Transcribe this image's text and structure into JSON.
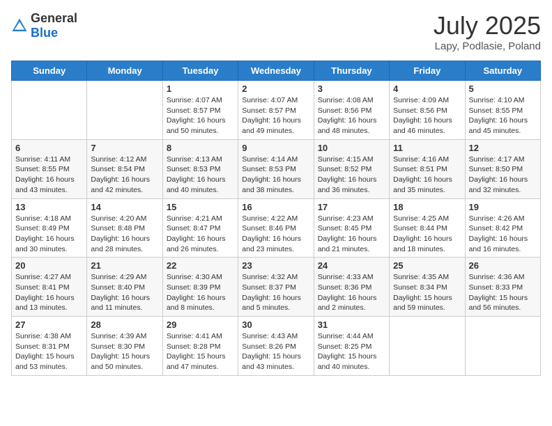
{
  "header": {
    "logo_general": "General",
    "logo_blue": "Blue",
    "month_title": "July 2025",
    "location": "Lapy, Podlasie, Poland"
  },
  "days_of_week": [
    "Sunday",
    "Monday",
    "Tuesday",
    "Wednesday",
    "Thursday",
    "Friday",
    "Saturday"
  ],
  "weeks": [
    [
      {
        "day": "",
        "info": ""
      },
      {
        "day": "",
        "info": ""
      },
      {
        "day": "1",
        "info": "Sunrise: 4:07 AM\nSunset: 8:57 PM\nDaylight: 16 hours\nand 50 minutes."
      },
      {
        "day": "2",
        "info": "Sunrise: 4:07 AM\nSunset: 8:57 PM\nDaylight: 16 hours\nand 49 minutes."
      },
      {
        "day": "3",
        "info": "Sunrise: 4:08 AM\nSunset: 8:56 PM\nDaylight: 16 hours\nand 48 minutes."
      },
      {
        "day": "4",
        "info": "Sunrise: 4:09 AM\nSunset: 8:56 PM\nDaylight: 16 hours\nand 46 minutes."
      },
      {
        "day": "5",
        "info": "Sunrise: 4:10 AM\nSunset: 8:55 PM\nDaylight: 16 hours\nand 45 minutes."
      }
    ],
    [
      {
        "day": "6",
        "info": "Sunrise: 4:11 AM\nSunset: 8:55 PM\nDaylight: 16 hours\nand 43 minutes."
      },
      {
        "day": "7",
        "info": "Sunrise: 4:12 AM\nSunset: 8:54 PM\nDaylight: 16 hours\nand 42 minutes."
      },
      {
        "day": "8",
        "info": "Sunrise: 4:13 AM\nSunset: 8:53 PM\nDaylight: 16 hours\nand 40 minutes."
      },
      {
        "day": "9",
        "info": "Sunrise: 4:14 AM\nSunset: 8:53 PM\nDaylight: 16 hours\nand 38 minutes."
      },
      {
        "day": "10",
        "info": "Sunrise: 4:15 AM\nSunset: 8:52 PM\nDaylight: 16 hours\nand 36 minutes."
      },
      {
        "day": "11",
        "info": "Sunrise: 4:16 AM\nSunset: 8:51 PM\nDaylight: 16 hours\nand 35 minutes."
      },
      {
        "day": "12",
        "info": "Sunrise: 4:17 AM\nSunset: 8:50 PM\nDaylight: 16 hours\nand 32 minutes."
      }
    ],
    [
      {
        "day": "13",
        "info": "Sunrise: 4:18 AM\nSunset: 8:49 PM\nDaylight: 16 hours\nand 30 minutes."
      },
      {
        "day": "14",
        "info": "Sunrise: 4:20 AM\nSunset: 8:48 PM\nDaylight: 16 hours\nand 28 minutes."
      },
      {
        "day": "15",
        "info": "Sunrise: 4:21 AM\nSunset: 8:47 PM\nDaylight: 16 hours\nand 26 minutes."
      },
      {
        "day": "16",
        "info": "Sunrise: 4:22 AM\nSunset: 8:46 PM\nDaylight: 16 hours\nand 23 minutes."
      },
      {
        "day": "17",
        "info": "Sunrise: 4:23 AM\nSunset: 8:45 PM\nDaylight: 16 hours\nand 21 minutes."
      },
      {
        "day": "18",
        "info": "Sunrise: 4:25 AM\nSunset: 8:44 PM\nDaylight: 16 hours\nand 18 minutes."
      },
      {
        "day": "19",
        "info": "Sunrise: 4:26 AM\nSunset: 8:42 PM\nDaylight: 16 hours\nand 16 minutes."
      }
    ],
    [
      {
        "day": "20",
        "info": "Sunrise: 4:27 AM\nSunset: 8:41 PM\nDaylight: 16 hours\nand 13 minutes."
      },
      {
        "day": "21",
        "info": "Sunrise: 4:29 AM\nSunset: 8:40 PM\nDaylight: 16 hours\nand 11 minutes."
      },
      {
        "day": "22",
        "info": "Sunrise: 4:30 AM\nSunset: 8:39 PM\nDaylight: 16 hours\nand 8 minutes."
      },
      {
        "day": "23",
        "info": "Sunrise: 4:32 AM\nSunset: 8:37 PM\nDaylight: 16 hours\nand 5 minutes."
      },
      {
        "day": "24",
        "info": "Sunrise: 4:33 AM\nSunset: 8:36 PM\nDaylight: 16 hours\nand 2 minutes."
      },
      {
        "day": "25",
        "info": "Sunrise: 4:35 AM\nSunset: 8:34 PM\nDaylight: 15 hours\nand 59 minutes."
      },
      {
        "day": "26",
        "info": "Sunrise: 4:36 AM\nSunset: 8:33 PM\nDaylight: 15 hours\nand 56 minutes."
      }
    ],
    [
      {
        "day": "27",
        "info": "Sunrise: 4:38 AM\nSunset: 8:31 PM\nDaylight: 15 hours\nand 53 minutes."
      },
      {
        "day": "28",
        "info": "Sunrise: 4:39 AM\nSunset: 8:30 PM\nDaylight: 15 hours\nand 50 minutes."
      },
      {
        "day": "29",
        "info": "Sunrise: 4:41 AM\nSunset: 8:28 PM\nDaylight: 15 hours\nand 47 minutes."
      },
      {
        "day": "30",
        "info": "Sunrise: 4:43 AM\nSunset: 8:26 PM\nDaylight: 15 hours\nand 43 minutes."
      },
      {
        "day": "31",
        "info": "Sunrise: 4:44 AM\nSunset: 8:25 PM\nDaylight: 15 hours\nand 40 minutes."
      },
      {
        "day": "",
        "info": ""
      },
      {
        "day": "",
        "info": ""
      }
    ]
  ]
}
